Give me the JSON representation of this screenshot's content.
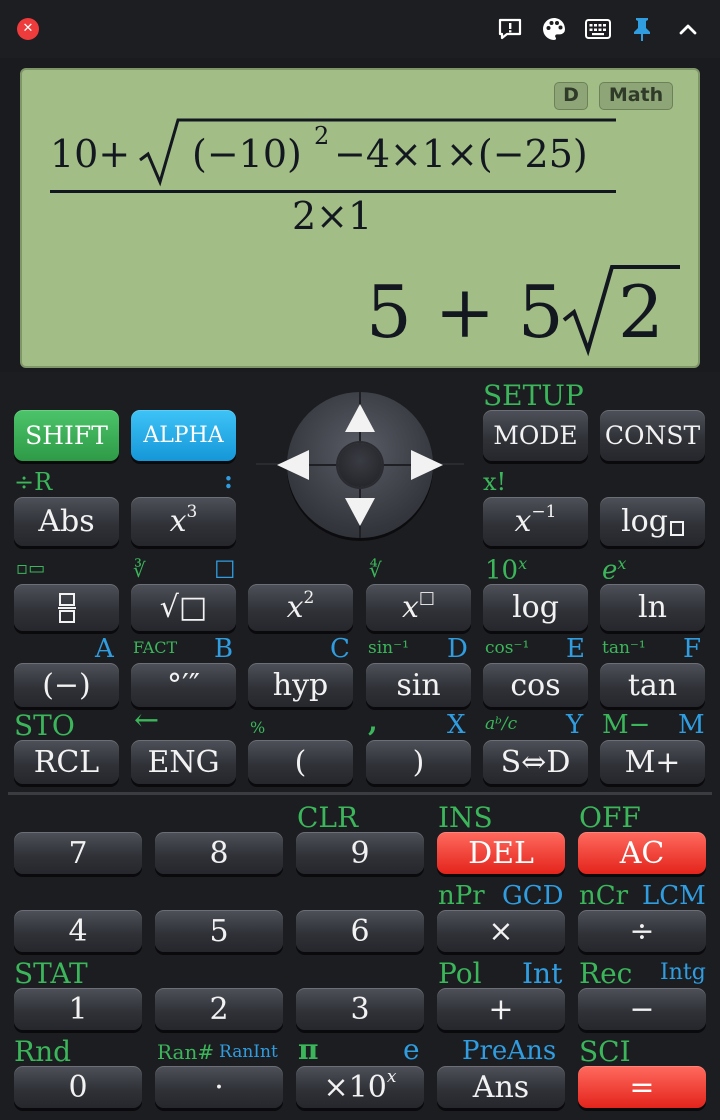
{
  "window": {
    "close_glyph": "✕",
    "toolbar_icons": [
      "feedback-icon",
      "palette-icon",
      "keyboard-icon",
      "pin-icon",
      "chevron-up-icon"
    ]
  },
  "display": {
    "mode_badge": "D",
    "input_badge": "Math",
    "expr": {
      "numerator_lead": "10+",
      "radicand_open": "(−10)",
      "square": "2",
      "radicand_rest": "−4×1×(−25)",
      "denominator": "2×1"
    },
    "result": {
      "integer": "5 + 5",
      "radicand": "2"
    }
  },
  "keys": {
    "shift": "SHIFT",
    "alpha": "ALPHA",
    "mode": "MODE",
    "const": "CONST",
    "abs": "Abs",
    "cube_base": "x",
    "cube_exp": "3",
    "reciprocal_base": "x",
    "reciprocal_exp": "−1",
    "log_base": "log",
    "fraction": "▭/▭",
    "sqrt": "√□",
    "square_base": "x",
    "square_exp": "2",
    "power_base": "x",
    "power_exp": "□",
    "log": "log",
    "ln": "ln",
    "negative": "(−)",
    "dms": "°′″",
    "hyp": "hyp",
    "sin": "sin",
    "cos": "cos",
    "tan": "tan",
    "rcl": "RCL",
    "eng": "ENG",
    "lparen": "(",
    "rparen": ")",
    "sd": "S⇔D",
    "mplus": "M+",
    "n7": "7",
    "n8": "8",
    "n9": "9",
    "del": "DEL",
    "ac": "AC",
    "n4": "4",
    "n5": "5",
    "n6": "6",
    "multiply": "×",
    "divide": "÷",
    "n1": "1",
    "n2": "2",
    "n3": "3",
    "plus": "+",
    "minus": "−",
    "n0": "0",
    "dot": "·",
    "exp_base": "×10",
    "exp_exp": "x",
    "ans": "Ans",
    "equals": "="
  },
  "labels": {
    "setup": "SETUP",
    "div_r": "÷R",
    "colon": ":",
    "factorial": "x!",
    "fraction_mixed": "▫▭",
    "cube_root": "∛",
    "cube_root_box": "☐",
    "xth_root": "∜",
    "ten_pow_base": "10",
    "ten_pow_exp": "x",
    "e_pow_base": "e",
    "e_pow_exp": "x",
    "A": "A",
    "fact": "FACT",
    "B": "B",
    "C": "C",
    "asin": "sin⁻¹",
    "D": "D",
    "acos": "cos⁻¹",
    "E": "E",
    "atan": "tan⁻¹",
    "F": "F",
    "sto": "STO",
    "left_arrow": "←",
    "percent": "%",
    "comma": ",",
    "X": "X",
    "ab_c": "aᵇ/c",
    "Y": "Y",
    "m_minus": "M−",
    "M": "M",
    "clr": "CLR",
    "ins": "INS",
    "off": "OFF",
    "npr": "nPr",
    "gcd": "GCD",
    "ncr": "nCr",
    "lcm": "LCM",
    "stat": "STAT",
    "pol": "Pol",
    "int": "Int",
    "rec": "Rec",
    "intg": "Intg",
    "rnd": "Rnd",
    "ran_hash": "Ran#",
    "ranint": "RanInt",
    "pi": "π",
    "e": "e",
    "preans": "PreAns",
    "sci": "SCI"
  }
}
